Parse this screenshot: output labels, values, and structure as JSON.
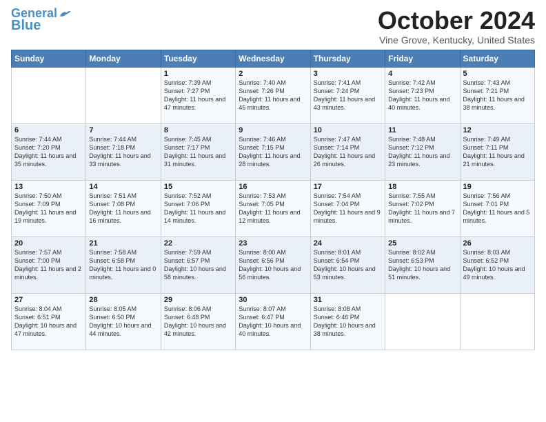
{
  "header": {
    "logo_line1": "General",
    "logo_line2": "Blue",
    "month": "October 2024",
    "location": "Vine Grove, Kentucky, United States"
  },
  "days_of_week": [
    "Sunday",
    "Monday",
    "Tuesday",
    "Wednesday",
    "Thursday",
    "Friday",
    "Saturday"
  ],
  "weeks": [
    [
      {
        "day": "",
        "sunrise": "",
        "sunset": "",
        "daylight": ""
      },
      {
        "day": "",
        "sunrise": "",
        "sunset": "",
        "daylight": ""
      },
      {
        "day": "1",
        "sunrise": "Sunrise: 7:39 AM",
        "sunset": "Sunset: 7:27 PM",
        "daylight": "Daylight: 11 hours and 47 minutes."
      },
      {
        "day": "2",
        "sunrise": "Sunrise: 7:40 AM",
        "sunset": "Sunset: 7:26 PM",
        "daylight": "Daylight: 11 hours and 45 minutes."
      },
      {
        "day": "3",
        "sunrise": "Sunrise: 7:41 AM",
        "sunset": "Sunset: 7:24 PM",
        "daylight": "Daylight: 11 hours and 43 minutes."
      },
      {
        "day": "4",
        "sunrise": "Sunrise: 7:42 AM",
        "sunset": "Sunset: 7:23 PM",
        "daylight": "Daylight: 11 hours and 40 minutes."
      },
      {
        "day": "5",
        "sunrise": "Sunrise: 7:43 AM",
        "sunset": "Sunset: 7:21 PM",
        "daylight": "Daylight: 11 hours and 38 minutes."
      }
    ],
    [
      {
        "day": "6",
        "sunrise": "Sunrise: 7:44 AM",
        "sunset": "Sunset: 7:20 PM",
        "daylight": "Daylight: 11 hours and 35 minutes."
      },
      {
        "day": "7",
        "sunrise": "Sunrise: 7:44 AM",
        "sunset": "Sunset: 7:18 PM",
        "daylight": "Daylight: 11 hours and 33 minutes."
      },
      {
        "day": "8",
        "sunrise": "Sunrise: 7:45 AM",
        "sunset": "Sunset: 7:17 PM",
        "daylight": "Daylight: 11 hours and 31 minutes."
      },
      {
        "day": "9",
        "sunrise": "Sunrise: 7:46 AM",
        "sunset": "Sunset: 7:15 PM",
        "daylight": "Daylight: 11 hours and 28 minutes."
      },
      {
        "day": "10",
        "sunrise": "Sunrise: 7:47 AM",
        "sunset": "Sunset: 7:14 PM",
        "daylight": "Daylight: 11 hours and 26 minutes."
      },
      {
        "day": "11",
        "sunrise": "Sunrise: 7:48 AM",
        "sunset": "Sunset: 7:12 PM",
        "daylight": "Daylight: 11 hours and 23 minutes."
      },
      {
        "day": "12",
        "sunrise": "Sunrise: 7:49 AM",
        "sunset": "Sunset: 7:11 PM",
        "daylight": "Daylight: 11 hours and 21 minutes."
      }
    ],
    [
      {
        "day": "13",
        "sunrise": "Sunrise: 7:50 AM",
        "sunset": "Sunset: 7:09 PM",
        "daylight": "Daylight: 11 hours and 19 minutes."
      },
      {
        "day": "14",
        "sunrise": "Sunrise: 7:51 AM",
        "sunset": "Sunset: 7:08 PM",
        "daylight": "Daylight: 11 hours and 16 minutes."
      },
      {
        "day": "15",
        "sunrise": "Sunrise: 7:52 AM",
        "sunset": "Sunset: 7:06 PM",
        "daylight": "Daylight: 11 hours and 14 minutes."
      },
      {
        "day": "16",
        "sunrise": "Sunrise: 7:53 AM",
        "sunset": "Sunset: 7:05 PM",
        "daylight": "Daylight: 11 hours and 12 minutes."
      },
      {
        "day": "17",
        "sunrise": "Sunrise: 7:54 AM",
        "sunset": "Sunset: 7:04 PM",
        "daylight": "Daylight: 11 hours and 9 minutes."
      },
      {
        "day": "18",
        "sunrise": "Sunrise: 7:55 AM",
        "sunset": "Sunset: 7:02 PM",
        "daylight": "Daylight: 11 hours and 7 minutes."
      },
      {
        "day": "19",
        "sunrise": "Sunrise: 7:56 AM",
        "sunset": "Sunset: 7:01 PM",
        "daylight": "Daylight: 11 hours and 5 minutes."
      }
    ],
    [
      {
        "day": "20",
        "sunrise": "Sunrise: 7:57 AM",
        "sunset": "Sunset: 7:00 PM",
        "daylight": "Daylight: 11 hours and 2 minutes."
      },
      {
        "day": "21",
        "sunrise": "Sunrise: 7:58 AM",
        "sunset": "Sunset: 6:58 PM",
        "daylight": "Daylight: 11 hours and 0 minutes."
      },
      {
        "day": "22",
        "sunrise": "Sunrise: 7:59 AM",
        "sunset": "Sunset: 6:57 PM",
        "daylight": "Daylight: 10 hours and 58 minutes."
      },
      {
        "day": "23",
        "sunrise": "Sunrise: 8:00 AM",
        "sunset": "Sunset: 6:56 PM",
        "daylight": "Daylight: 10 hours and 56 minutes."
      },
      {
        "day": "24",
        "sunrise": "Sunrise: 8:01 AM",
        "sunset": "Sunset: 6:54 PM",
        "daylight": "Daylight: 10 hours and 53 minutes."
      },
      {
        "day": "25",
        "sunrise": "Sunrise: 8:02 AM",
        "sunset": "Sunset: 6:53 PM",
        "daylight": "Daylight: 10 hours and 51 minutes."
      },
      {
        "day": "26",
        "sunrise": "Sunrise: 8:03 AM",
        "sunset": "Sunset: 6:52 PM",
        "daylight": "Daylight: 10 hours and 49 minutes."
      }
    ],
    [
      {
        "day": "27",
        "sunrise": "Sunrise: 8:04 AM",
        "sunset": "Sunset: 6:51 PM",
        "daylight": "Daylight: 10 hours and 47 minutes."
      },
      {
        "day": "28",
        "sunrise": "Sunrise: 8:05 AM",
        "sunset": "Sunset: 6:50 PM",
        "daylight": "Daylight: 10 hours and 44 minutes."
      },
      {
        "day": "29",
        "sunrise": "Sunrise: 8:06 AM",
        "sunset": "Sunset: 6:48 PM",
        "daylight": "Daylight: 10 hours and 42 minutes."
      },
      {
        "day": "30",
        "sunrise": "Sunrise: 8:07 AM",
        "sunset": "Sunset: 6:47 PM",
        "daylight": "Daylight: 10 hours and 40 minutes."
      },
      {
        "day": "31",
        "sunrise": "Sunrise: 8:08 AM",
        "sunset": "Sunset: 6:46 PM",
        "daylight": "Daylight: 10 hours and 38 minutes."
      },
      {
        "day": "",
        "sunrise": "",
        "sunset": "",
        "daylight": ""
      },
      {
        "day": "",
        "sunrise": "",
        "sunset": "",
        "daylight": ""
      }
    ]
  ]
}
